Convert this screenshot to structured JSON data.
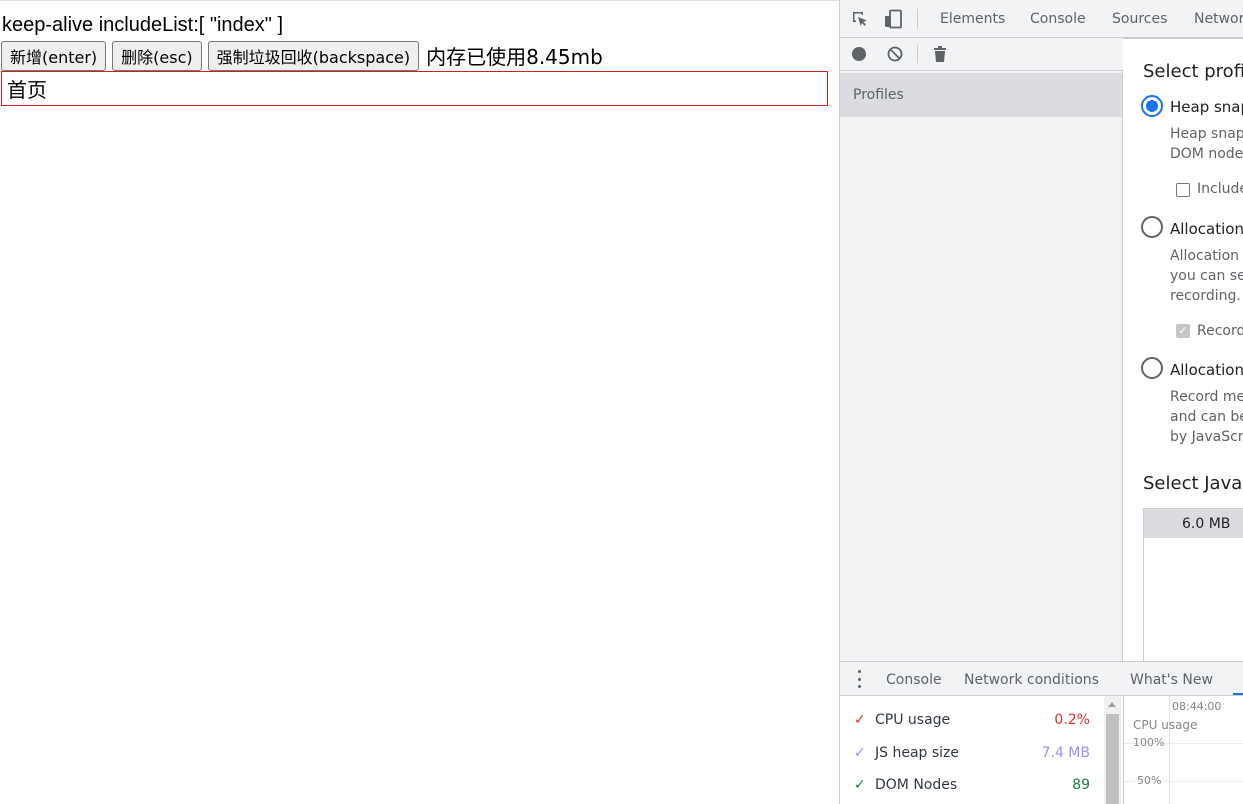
{
  "page": {
    "heading": "keep-alive includeList:[ \"index\" ]",
    "buttons": {
      "add": "新增(enter)",
      "delete": "删除(esc)",
      "gc": "强制垃圾回收(backspace)"
    },
    "memory_text": "内存已使用8.45mb",
    "item_label": "首页"
  },
  "devtools": {
    "tabs": [
      "Elements",
      "Console",
      "Sources",
      "Network"
    ],
    "sidebar": {
      "profiles_label": "Profiles"
    },
    "main": {
      "select_profiling_type": "Select profiling type",
      "options": [
        {
          "label": "Heap snapshot",
          "selected": true,
          "description_lines": [
            "Heap snapshot profiles show memory distribution among your page's JavaScript objects and related",
            "DOM nodes."
          ]
        },
        {
          "label": "Allocation instrumentation on timeline",
          "selected": false,
          "description_lines": [
            "Allocation timelines show instrumented JavaScript memory allocations over time. Once profile is recorded",
            "you can select a time interval to see objects that were allocated within it and still alive by the end of",
            "recording. Use this profile type to isolate memory leaks."
          ]
        },
        {
          "label": "Allocation sampling",
          "selected": false,
          "description_lines": [
            "Record memory allocations using sampling method. This profile type has minimal performance overhead",
            "and can be used for long running operations. It provides good approximation of allocations broken down",
            "by JavaScript execution stack."
          ]
        }
      ],
      "include_checkbox_label": "Include numerical values in capture",
      "record_checkbox_label": "Record stack traces of allocations",
      "select_vm_title": "Select JavaScript VM instance",
      "vm_heap": "6.0 MB"
    },
    "drawer": {
      "tabs": [
        "Console",
        "Network conditions",
        "What's New"
      ],
      "metrics": [
        {
          "name": "CPU usage",
          "value": "0.2%",
          "color": "#d93025"
        },
        {
          "name": "JS heap size",
          "value": "7.4 MB",
          "color": "#9e8fef"
        },
        {
          "name": "DOM Nodes",
          "value": "89",
          "color": "#188038"
        }
      ],
      "graph": {
        "time": "08:44:00",
        "label": "CPU usage",
        "tick_100": "100%",
        "tick_50": "50%"
      }
    }
  }
}
